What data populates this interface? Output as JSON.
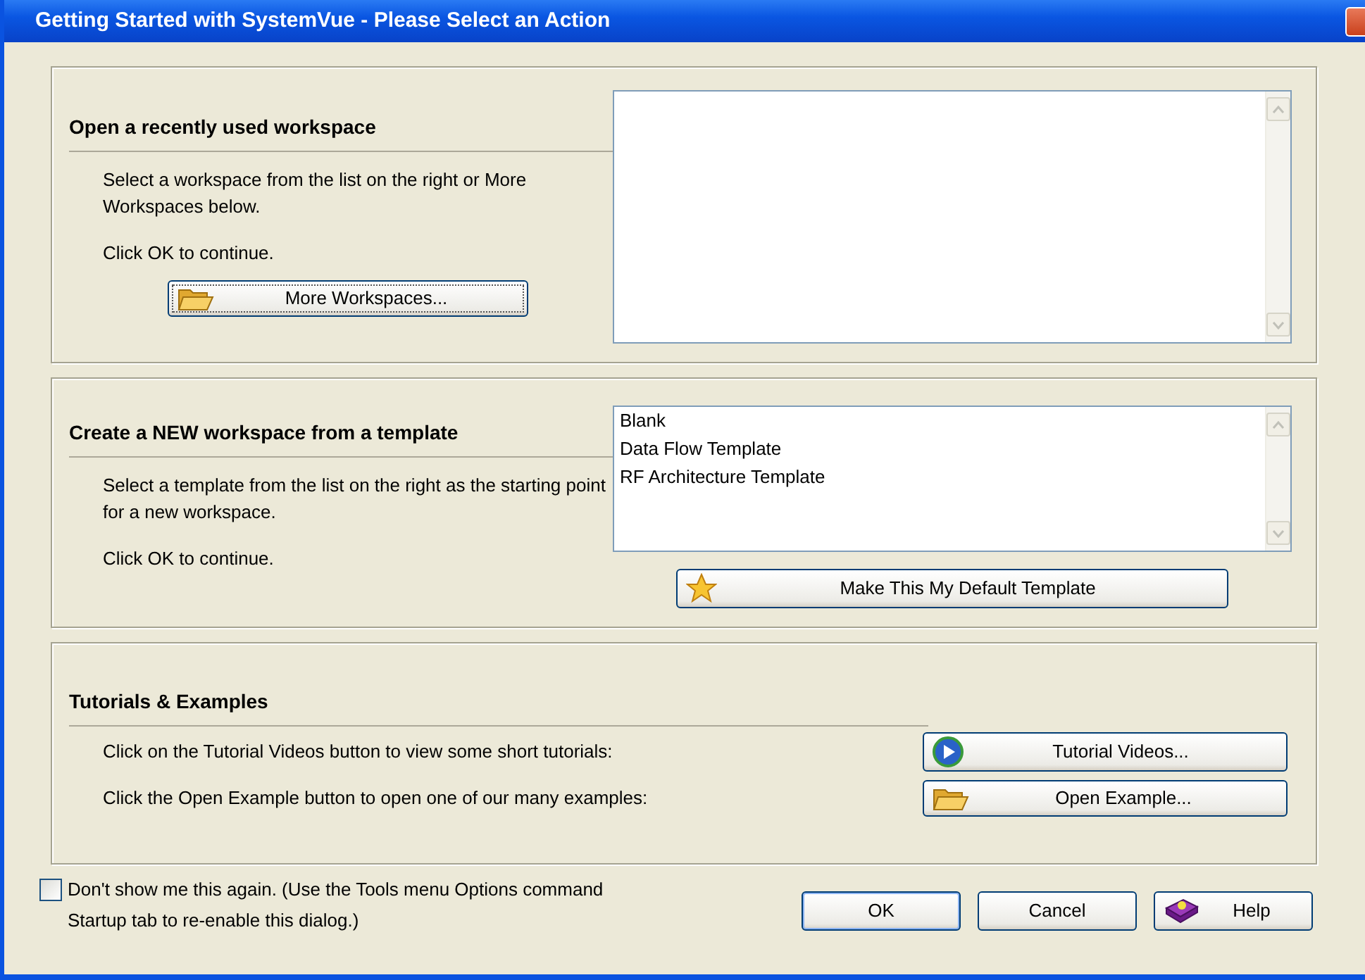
{
  "window": {
    "title": "Getting Started with SystemVue - Please Select an Action"
  },
  "sections": [
    {
      "kind": "list",
      "heading": "Open a recently used workspace",
      "paragraphs": [
        "Select a workspace from the list on the right or More Workspaces below.",
        "Click OK to continue."
      ],
      "button": {
        "label": "More Workspaces..."
      }
    },
    {
      "kind": "list",
      "heading": "Create a NEW workspace from a template",
      "paragraphs": [
        "Select a template from the list on the right as the starting point for a new workspace.",
        "Click OK to continue."
      ],
      "items": [
        "Blank",
        "Data Flow Template",
        "RF Architecture Template"
      ],
      "button": {
        "label": "Make This My Default Template"
      }
    },
    {
      "kind": "actions",
      "heading": "Tutorials & Examples",
      "rows": [
        {
          "text": "Click on the Tutorial Videos button to view some short tutorials:",
          "button": {
            "label": "Tutorial Videos..."
          }
        },
        {
          "text": "Click the Open Example button to open one of our many examples:",
          "button": {
            "label": "Open Example..."
          }
        }
      ]
    }
  ],
  "footer": {
    "checkbox": {
      "label": "Don't show me this again. (Use the Tools menu Options command Startup tab to re-enable this dialog.)",
      "checked": false
    },
    "buttons": [
      {
        "label": "OK"
      },
      {
        "label": "Cancel"
      },
      {
        "label": "Help"
      }
    ]
  }
}
